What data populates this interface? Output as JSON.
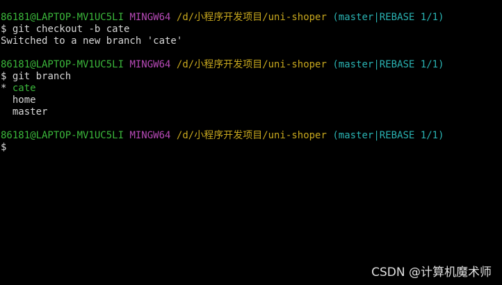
{
  "colors": {
    "background": "#000000",
    "text": "#d8d8d8",
    "user_host": "#3bb83b",
    "msystem": "#b84ab8",
    "cwd": "#c8a81e",
    "git_status": "#2ab3b3",
    "current_branch": "#3bb83b"
  },
  "prompt": {
    "user_host": "86181@LAPTOP-MV1UC5LI",
    "msystem": "MINGW64",
    "cwd": "/d/小程序开发项目/uni-shoper",
    "git_status": "(master|REBASE 1/1)",
    "symbol": "$"
  },
  "blocks": [
    {
      "command": "git checkout -b cate",
      "output": [
        "Switched to a new branch 'cate'"
      ]
    },
    {
      "command": "git branch",
      "branches": [
        {
          "marker": "*",
          "name": "cate",
          "current": true
        },
        {
          "marker": "",
          "name": "home",
          "current": false
        },
        {
          "marker": "",
          "name": "master",
          "current": false
        }
      ]
    }
  ],
  "watermark": "CSDN @计算机魔术师"
}
